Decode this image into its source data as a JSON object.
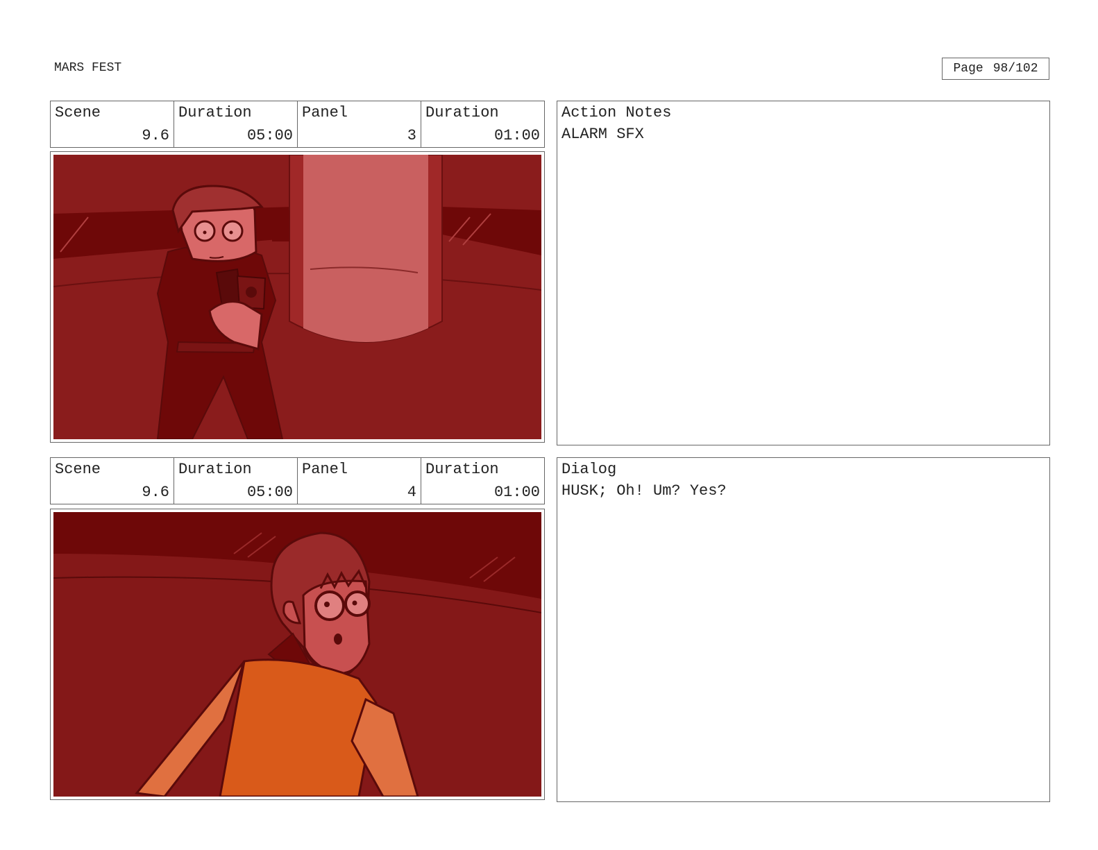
{
  "document": {
    "title": "MARS FEST",
    "page_label": "Page",
    "page_number": "98/102"
  },
  "panels": [
    {
      "scene_label": "Scene",
      "scene": "9.6",
      "scene_duration_label": "Duration",
      "scene_duration": "05:00",
      "panel_label": "Panel",
      "panel": "3",
      "panel_duration_label": "Duration",
      "panel_duration": "01:00",
      "notes_label": "Action Notes",
      "notes_text": "ALARM SFX"
    },
    {
      "scene_label": "Scene",
      "scene": "9.6",
      "scene_duration_label": "Duration",
      "scene_duration": "05:00",
      "panel_label": "Panel",
      "panel": "4",
      "panel_duration_label": "Duration",
      "panel_duration": "01:00",
      "notes_label": "Dialog",
      "notes_text": "HUSK; Oh! Um? Yes?"
    }
  ],
  "colors": {
    "alarm_red": "#8a1c1c",
    "dark_red": "#6e0808",
    "skin_pink": "#e07070",
    "shirt_orange": "#d95a1a"
  }
}
